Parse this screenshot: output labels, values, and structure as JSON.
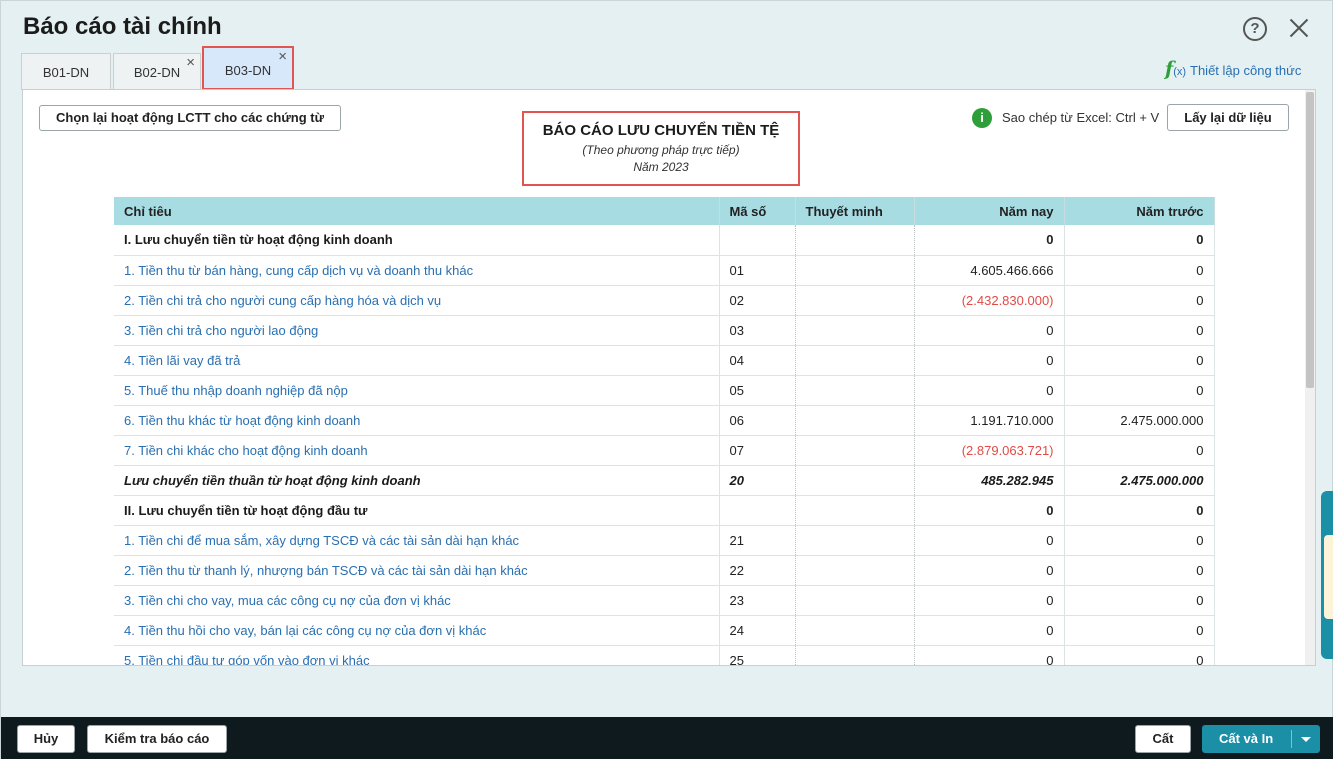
{
  "window": {
    "title": "Báo cáo tài chính",
    "help_label": "?"
  },
  "tabs": [
    {
      "label": "B01-DN",
      "closable": false,
      "active": false
    },
    {
      "label": "B02-DN",
      "closable": true,
      "active": false
    },
    {
      "label": "B03-DN",
      "closable": true,
      "active": true
    }
  ],
  "tab_close_glyph": "×",
  "formula_link": {
    "icon": "f",
    "icon_sub": "(x)",
    "label": "Thiết lập công thức"
  },
  "toolbar": {
    "reselect_label": "Chọn lại hoạt động LCTT cho các chứng từ",
    "copy_hint": "Sao chép từ Excel: Ctrl + V",
    "info_glyph": "i",
    "reload_label": "Lấy lại dữ liệu"
  },
  "report": {
    "title": "BÁO CÁO LƯU CHUYỂN TIỀN TỆ",
    "subtitle": "(Theo phương pháp trực tiếp)",
    "year": "Năm 2023"
  },
  "table": {
    "columns": [
      "Chỉ tiêu",
      "Mã số",
      "Thuyết minh",
      "Năm nay",
      "Năm trước"
    ],
    "rows": [
      {
        "type": "header",
        "label": "I. Lưu chuyển tiền từ hoạt động kinh doanh",
        "code": "",
        "note": "",
        "this_year": "0",
        "last_year": "0"
      },
      {
        "type": "item",
        "label": "1. Tiền thu từ bán hàng, cung cấp dịch vụ và doanh thu khác",
        "code": "01",
        "note": "",
        "this_year": "4.605.466.666",
        "last_year": "0"
      },
      {
        "type": "item",
        "label": "2. Tiền chi trả cho người cung cấp hàng hóa và dịch vụ",
        "code": "02",
        "note": "",
        "this_year": "(2.432.830.000)",
        "last_year": "0"
      },
      {
        "type": "item",
        "label": "3. Tiền chi trả cho người lao động",
        "code": "03",
        "note": "",
        "this_year": "0",
        "last_year": "0"
      },
      {
        "type": "item",
        "label": "4. Tiền lãi vay đã trả",
        "code": "04",
        "note": "",
        "this_year": "0",
        "last_year": "0"
      },
      {
        "type": "item",
        "label": "5. Thuế thu nhập doanh nghiệp đã nộp",
        "code": "05",
        "note": "",
        "this_year": "0",
        "last_year": "0"
      },
      {
        "type": "item",
        "label": "6. Tiền thu khác từ hoạt động kinh doanh",
        "code": "06",
        "note": "",
        "this_year": "1.191.710.000",
        "last_year": "2.475.000.000"
      },
      {
        "type": "item",
        "label": "7. Tiền chi khác cho hoạt động kinh doanh",
        "code": "07",
        "note": "",
        "this_year": "(2.879.063.721)",
        "last_year": "0"
      },
      {
        "type": "total",
        "label": "Lưu chuyển tiền thuần từ hoạt động kinh doanh",
        "code": "20",
        "note": "",
        "this_year": "485.282.945",
        "last_year": "2.475.000.000"
      },
      {
        "type": "header",
        "label": "II. Lưu chuyển tiền từ hoạt động đầu tư",
        "code": "",
        "note": "",
        "this_year": "0",
        "last_year": "0"
      },
      {
        "type": "item",
        "label": "1. Tiền chi để mua sắm, xây dựng TSCĐ và các tài sản dài hạn khác",
        "code": "21",
        "note": "",
        "this_year": "0",
        "last_year": "0"
      },
      {
        "type": "item",
        "label": "2. Tiền thu từ thanh lý, nhượng bán TSCĐ và các tài sản dài hạn khác",
        "code": "22",
        "note": "",
        "this_year": "0",
        "last_year": "0"
      },
      {
        "type": "item",
        "label": "3. Tiền chi cho vay, mua các công cụ nợ của đơn vị khác",
        "code": "23",
        "note": "",
        "this_year": "0",
        "last_year": "0"
      },
      {
        "type": "item",
        "label": "4. Tiền thu hồi cho vay, bán lại các công cụ nợ của đơn vị khác",
        "code": "24",
        "note": "",
        "this_year": "0",
        "last_year": "0"
      },
      {
        "type": "item",
        "label": "5. Tiền chi đầu tư góp vốn vào đơn vị khác",
        "code": "25",
        "note": "",
        "this_year": "0",
        "last_year": "0"
      }
    ]
  },
  "footer": {
    "cancel_label": "Hủy",
    "check_label": "Kiểm tra báo cáo",
    "save_label": "Cất",
    "save_print_label": "Cất và In"
  },
  "colors": {
    "accent": "#1b8fa6",
    "link": "#2a6fb0",
    "negative": "#e04b45",
    "table_header": "#a8dce3",
    "highlight_border": "#e25450"
  },
  "icons": {
    "help": "help-circle-icon",
    "close": "close-icon",
    "info": "info-circle-icon",
    "formula": "function-fx-icon",
    "dropdown": "caret-down-icon"
  }
}
